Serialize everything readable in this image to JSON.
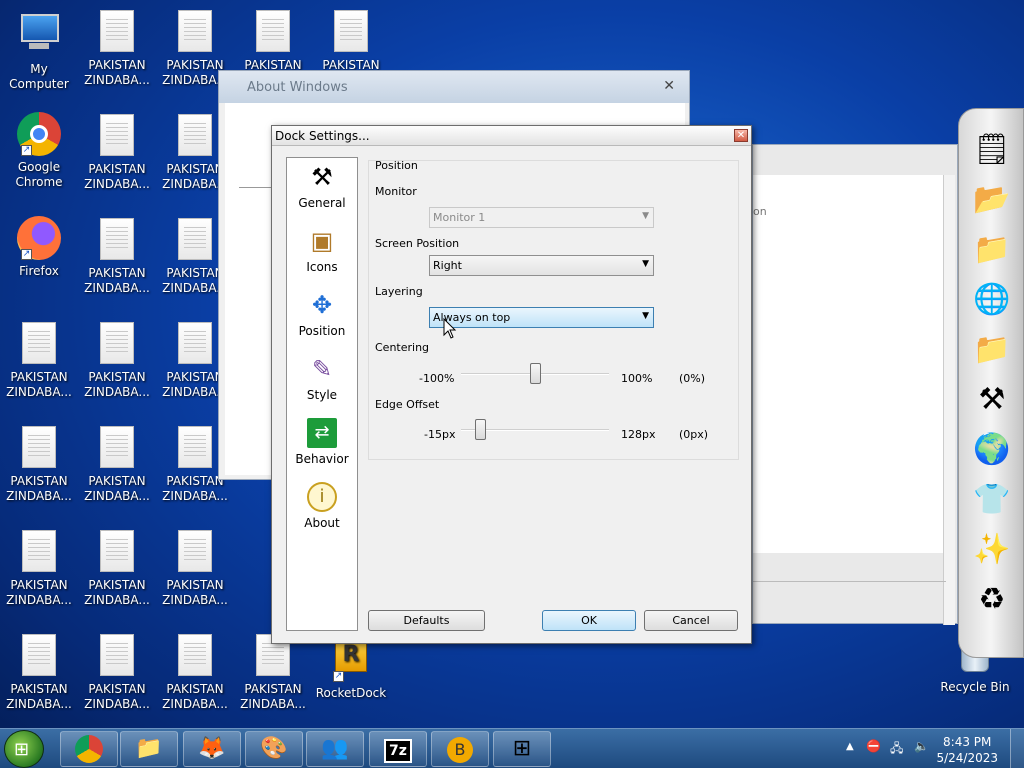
{
  "desktop": {
    "my_computer": "My Computer",
    "chrome": [
      "Google",
      "Chrome"
    ],
    "firefox": "Firefox",
    "file_line1": "PAKISTAN",
    "file_line2": "ZINDABA...",
    "rocketdock": "RocketDock",
    "recycle_bin": "Recycle Bin"
  },
  "about_window": {
    "title": "About Windows"
  },
  "bg_window": {
    "text": "on"
  },
  "dialog": {
    "title": "Dock Settings...",
    "nav": [
      {
        "label": "General",
        "icon": "tools-icon"
      },
      {
        "label": "Icons",
        "icon": "box-icon"
      },
      {
        "label": "Position",
        "icon": "arrows-icon"
      },
      {
        "label": "Style",
        "icon": "brush-icon"
      },
      {
        "label": "Behavior",
        "icon": "green-arrows-icon"
      },
      {
        "label": "About",
        "icon": "info-icon"
      }
    ],
    "section_title": "Position",
    "monitor_label": "Monitor",
    "monitor_value": "Monitor 1",
    "screen_position_label": "Screen Position",
    "screen_position_value": "Right",
    "layering_label": "Layering",
    "layering_value": "Always on top",
    "centering_label": "Centering",
    "centering_min": "-100%",
    "centering_max": "100%",
    "centering_value": "(0%)",
    "edge_offset_label": "Edge Offset",
    "edge_min": "-15px",
    "edge_max": "128px",
    "edge_value": "(0px)",
    "defaults_button": "Defaults",
    "ok_button": "OK",
    "cancel_button": "Cancel"
  },
  "taskbar": {
    "clock_time": "8:43 PM",
    "clock_date": "5/24/2023"
  }
}
